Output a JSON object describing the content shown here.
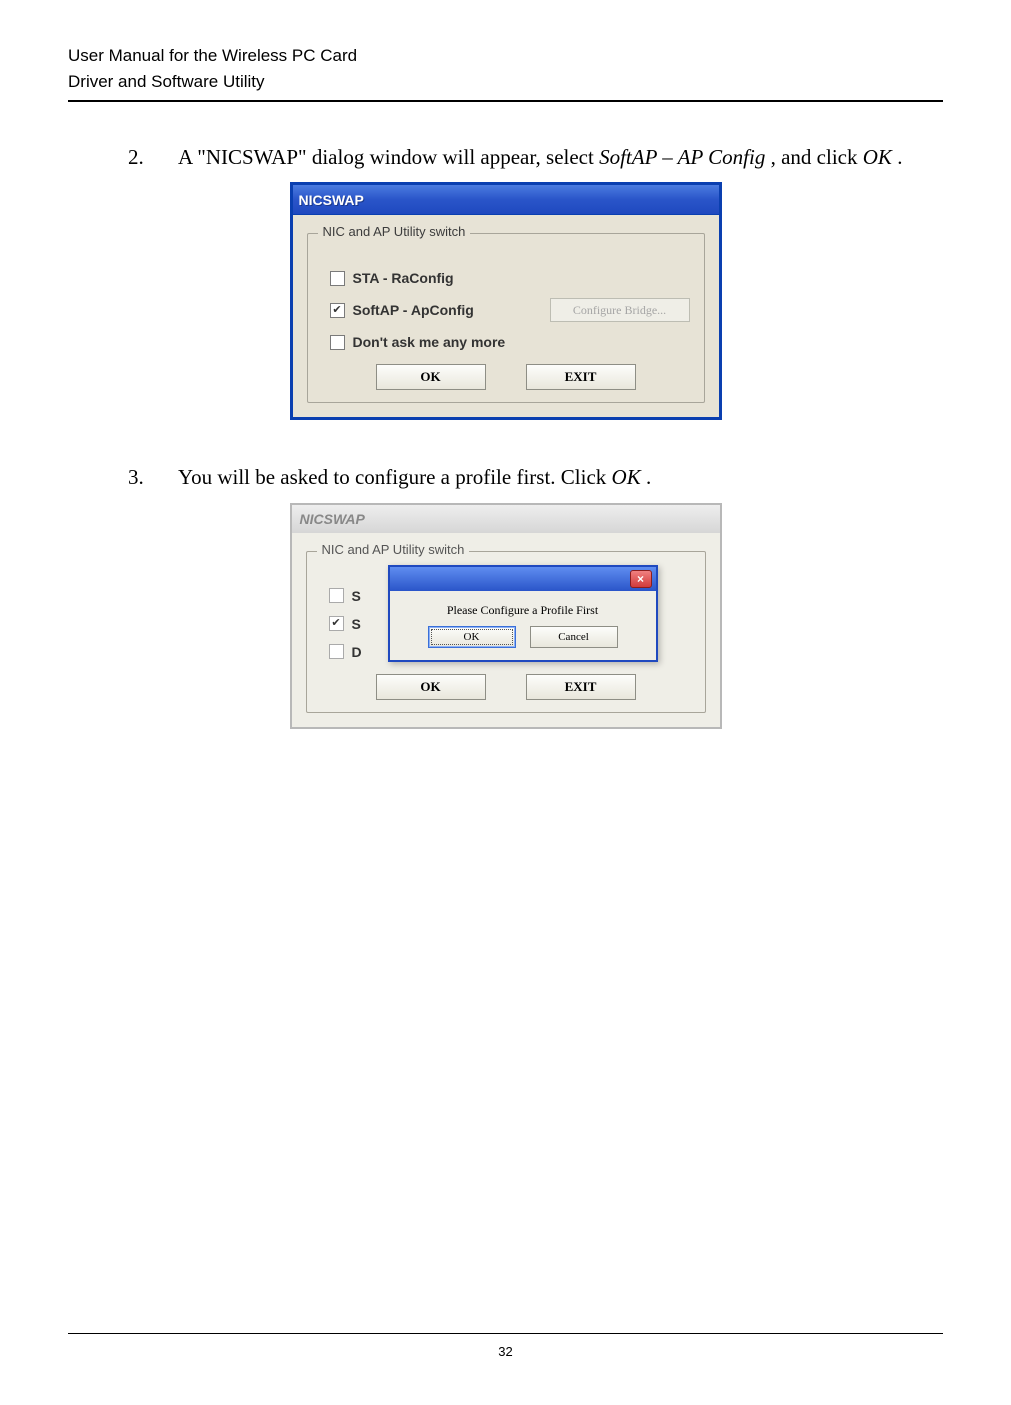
{
  "header": {
    "line1": "User Manual for the Wireless PC Card",
    "line2": "Driver and Software Utility"
  },
  "steps": {
    "s2": {
      "num": "2.",
      "pre": "A \"NICSWAP\" dialog window will appear, select ",
      "em1": "SoftAP – AP Config",
      "mid": ", and click ",
      "em2": "OK",
      "post": "."
    },
    "s3": {
      "num": "3.",
      "pre": "You will be asked to configure a profile first. Click ",
      "em1": "OK",
      "post": "."
    }
  },
  "dialog1": {
    "title": "NICSWAP",
    "group_legend": "NIC and AP Utility switch",
    "opt_sta": "STA - RaConfig",
    "opt_softap": "SoftAP - ApConfig",
    "configure_bridge": "Configure Bridge...",
    "opt_dontask": "Don't ask me any more",
    "btn_ok": "OK",
    "btn_exit": "EXIT"
  },
  "dialog2": {
    "title": "NICSWAP",
    "group_legend": "NIC and AP Utility switch",
    "opt_sta_trunc": "S",
    "opt_softap_trunc": "S",
    "opt_dontask_trunc": "D",
    "btn_ok": "OK",
    "btn_exit": "EXIT",
    "popup": {
      "close": "×",
      "message": "Please Configure a Profile First",
      "btn_ok": "OK",
      "btn_cancel": "Cancel"
    }
  },
  "footer": {
    "page": "32"
  }
}
